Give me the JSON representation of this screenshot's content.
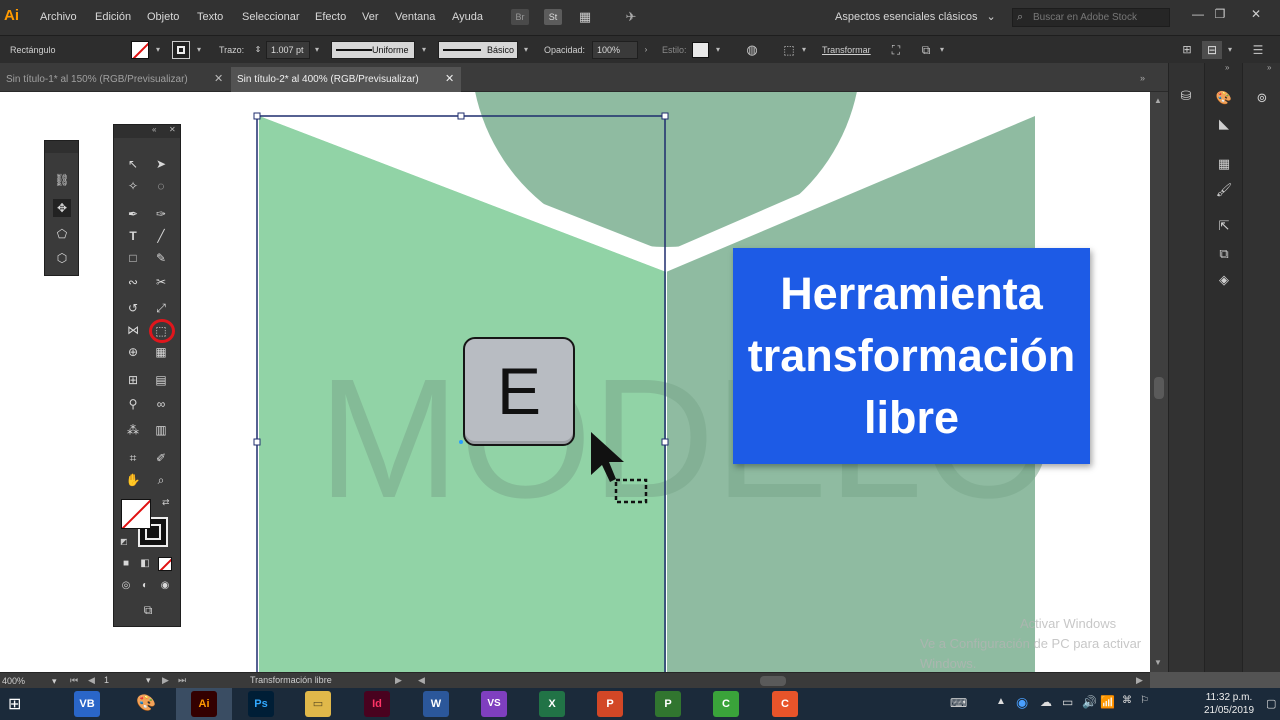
{
  "app": {
    "logo": "Ai",
    "menus": [
      "Archivo",
      "Edición",
      "Objeto",
      "Texto",
      "Seleccionar",
      "Efecto",
      "Ver",
      "Ventana",
      "Ayuda"
    ],
    "menubar_icons": [
      "Br",
      "St"
    ],
    "workspace": "Aspectos esenciales clásicos",
    "stock_search_placeholder": "Buscar en Adobe Stock",
    "window_controls": [
      "—",
      "❐",
      "✕"
    ]
  },
  "control_bar": {
    "object_type": "Rectángulo",
    "stroke_label": "Trazo:",
    "stroke_weight": "1.007 pt",
    "profile": "Uniforme",
    "brush": "Básico",
    "opacity_label": "Opacidad:",
    "opacity_value": "100%",
    "style_label": "Estilo:",
    "transform_label": "Transformar"
  },
  "tabs": [
    {
      "label": "Sin título-1* al 150% (RGB/Previsualizar)",
      "active": false
    },
    {
      "label": "Sin título-2* al 400% (RGB/Previsualizar)",
      "active": true
    }
  ],
  "status_bar": {
    "zoom": "400%",
    "artboard": "1",
    "tool_name": "Transformación libre"
  },
  "canvas": {
    "watermark_text": "MODELO",
    "shortcut_key": "E",
    "callout_lines": [
      "Herramienta",
      "transformación",
      "libre"
    ],
    "windows_activation": [
      "Activar Windows",
      "Ve a Configuración de PC para activar Windows."
    ]
  },
  "taskbar": {
    "apps": [
      "VB",
      "Ai",
      "Ps",
      "Id",
      "W",
      "VS",
      "X",
      "P",
      "P",
      "C",
      "C"
    ],
    "time": "11:32 p.m.",
    "date": "21/05/2019"
  },
  "colors": {
    "callout_blue": "#1d5be6",
    "green_light": "#91d3a6",
    "green_muted": "#8fbba1",
    "selection": "#1f2d6e",
    "illustrator_orange": "#ff9a00"
  }
}
